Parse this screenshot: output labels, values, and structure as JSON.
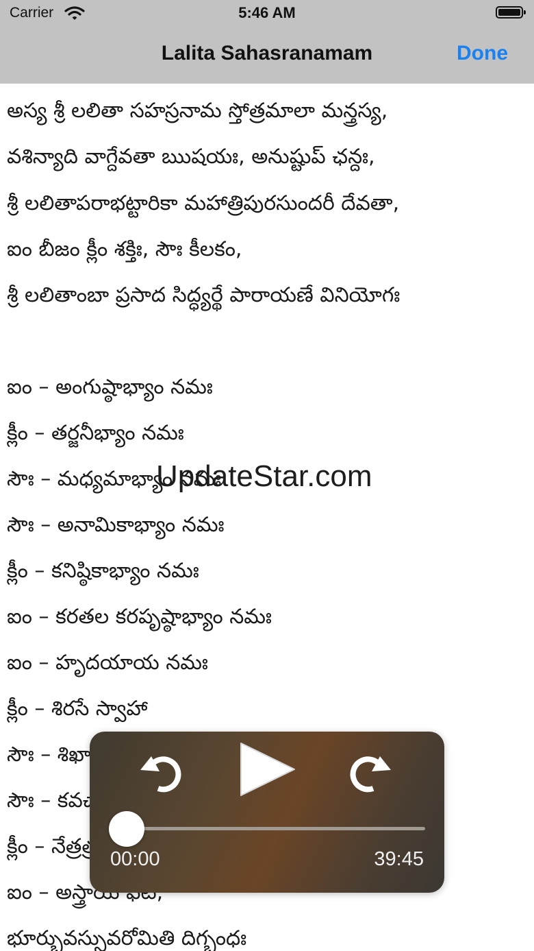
{
  "status_bar": {
    "carrier": "Carrier",
    "time": "5:46 AM",
    "wifi_icon": "wifi-icon",
    "battery_icon": "battery-icon"
  },
  "nav": {
    "title": "Lalita Sahasranamam",
    "done_label": "Done",
    "accent_color": "#1a82f0",
    "bar_color": "#c2c2c2"
  },
  "lines": [
    "అస్య శ్రీ లలితా సహస్రనామ స్తోత్రమాలా మన్త్రస్య,",
    "వశిన్యాది వాగ్దేవతా ఋషయః, అనుష్టుప్ ఛన్దః,",
    "శ్రీ లలితాపరాభట్టారికా మహాత్రిపురసుందరీ దేవతా,",
    "ఐం బీజం క్లీం శక్తిః, సౌః కీలకం,",
    "శ్రీ లలితాంబా ప్రసాద సిద్ధ్యర్థే పారాయణే వినియోగః",
    "",
    "ఐం – అంగుష్ఠాభ్యాం నమః",
    "క్లీం – తర్జనీభ్యాం నమః",
    "సౌః – మధ్యమాభ్యాం నమః",
    "సౌః – అనామికాభ్యాం నమః",
    "క్లీం – కనిష్ఠికాభ్యాం నమః",
    "ఐం – కరతల కరపృష్ఠాభ్యాం నమః",
    "ఐం – హృదయాయ నమః",
    "క్లీం – శిరసే స్వాహా",
    "సౌః – శిఖాయై వషట్",
    "సౌః – కవచాయ హుం",
    "క్లీం – నేత్రత్రయాయ వౌషట్",
    "ఐం – అస్త్రాయ ఫట్,",
    "భూర్భువస్సువరోమితి దిగ్బంధః"
  ],
  "watermark": "UpdateStar.com",
  "player": {
    "elapsed": "00:00",
    "total": "39:45",
    "progress": 0.0,
    "skip_back_icon": "skip-back-icon",
    "play_icon": "play-icon",
    "skip_forward_icon": "skip-forward-icon"
  }
}
